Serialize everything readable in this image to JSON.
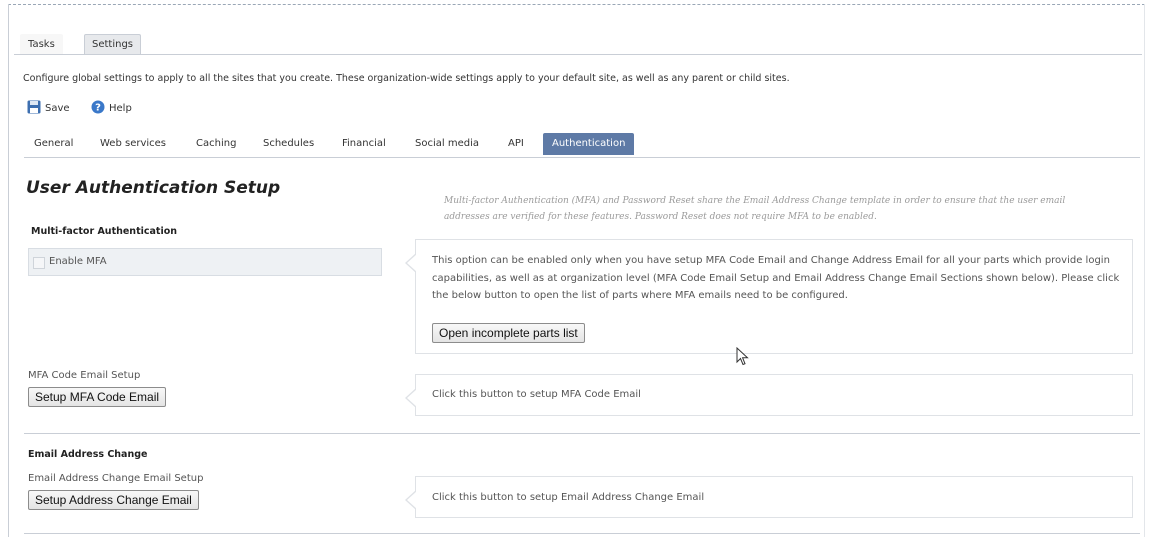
{
  "tabs": [
    {
      "label": "Tasks",
      "active": false
    },
    {
      "label": "Settings",
      "active": true
    }
  ],
  "description": "Configure global settings to apply to all the sites that you create. These organization-wide settings apply to your default site, as well as any parent or child sites.",
  "toolbar": {
    "save_label": "Save",
    "help_label": "Help",
    "save_icon": "floppy-disk-icon",
    "help_icon": "help-icon"
  },
  "subtabs": [
    {
      "label": "General",
      "active": false
    },
    {
      "label": "Web services",
      "active": false
    },
    {
      "label": "Caching",
      "active": false
    },
    {
      "label": "Schedules",
      "active": false
    },
    {
      "label": "Financial",
      "active": false
    },
    {
      "label": "Social media",
      "active": false
    },
    {
      "label": "API",
      "active": false
    },
    {
      "label": "Authentication",
      "active": true
    }
  ],
  "page": {
    "title": "User Authentication Setup",
    "note": "Multi-factor Authentication (MFA) and Password Reset share the Email Address Change template in order to ensure that the user email addresses are verified for these features. Password Reset does not require MFA to be enabled."
  },
  "mfa": {
    "heading": "Multi-factor Authentication",
    "enable_label": "Enable MFA",
    "enabled": false,
    "info": "This option can be enabled only when you have setup MFA Code Email and Change Address Email for all your parts which provide login capabilities, as well as at organization level (MFA Code Email Setup and Email Address Change Email Sections shown below). Please click the below button to open the list of parts where MFA emails need to be configured.",
    "open_list_button": "Open incomplete parts list",
    "code_email_label": "MFA Code Email Setup",
    "code_email_button": "Setup MFA Code Email",
    "code_email_info": "Click this button to setup MFA Code Email"
  },
  "email_change": {
    "heading": "Email Address Change",
    "setup_label": "Email Address Change Email Setup",
    "setup_button": "Setup Address Change Email",
    "info": "Click this button to setup Email Address Change Email"
  },
  "colors": {
    "active_subtab": "#5e7aa6",
    "help_icon": "#3a78c9",
    "save_icon": "#3d6fb0"
  }
}
